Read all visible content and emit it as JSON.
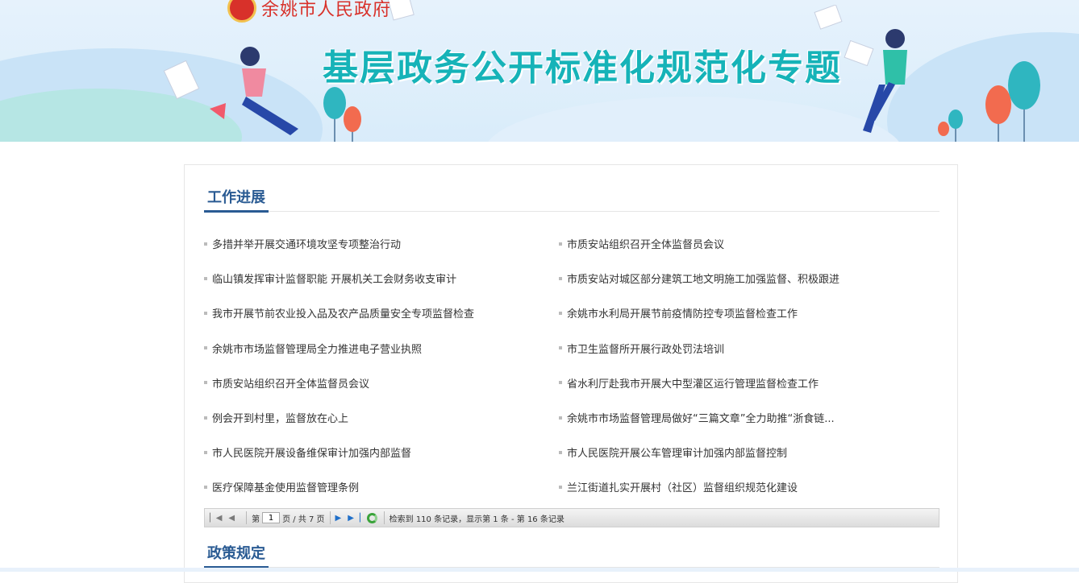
{
  "banner": {
    "logo_text": "余姚市人民政府",
    "title": "基层政务公开标准化规范化专题"
  },
  "section1": {
    "title": "工作进展",
    "items": [
      "多措并举开展交通环境攻坚专项整治行动",
      "市质安站组织召开全体监督员会议",
      "临山镇发挥审计监督职能 开展机关工会财务收支审计",
      "市质安站对城区部分建筑工地文明施工加强监督、积极跟进",
      "我市开展节前农业投入品及农产品质量安全专项监督检查",
      "余姚市水利局开展节前疫情防控专项监督检查工作",
      "余姚市市场监督管理局全力推进电子营业执照",
      "市卫生监督所开展行政处罚法培训",
      "市质安站组织召开全体监督员会议",
      "省水利厅赴我市开展大中型灌区运行管理监督检查工作",
      "例会开到村里，监督放在心上",
      "余姚市市场监督管理局做好“三篇文章”全力助推“浙食链...",
      "市人民医院开展设备维保审计加强内部监督",
      "市人民医院开展公车管理审计加强内部监督控制",
      "医疗保障基金使用监督管理条例",
      "兰江街道扎实开展村（社区）监督组织规范化建设"
    ]
  },
  "pager": {
    "page_prefix": "第",
    "page_value": "1",
    "page_suffix": "页 / 共 7 页",
    "status": "检索到 110 条记录，显示第 1 条 - 第 16 条记录"
  },
  "section2": {
    "title": "政策规定"
  },
  "colors": {
    "accent": "#2a5b93",
    "banner_title": "#16b3b8",
    "logo_red": "#d8312a"
  }
}
